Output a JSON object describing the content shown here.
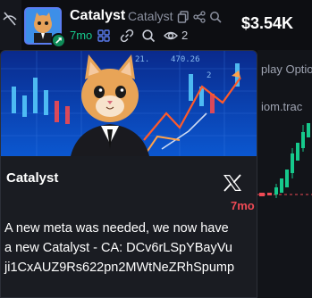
{
  "header": {
    "token_name": "Catalyst",
    "token_ticker": "Catalyst",
    "age": "7mo",
    "holders_count": "2",
    "market_cap": "$3.54K",
    "icons": [
      "copy-icon",
      "share-icon",
      "search-icon",
      "people-icon",
      "link-icon",
      "eye-icon"
    ]
  },
  "background": {
    "display_options_text": "play Optio",
    "domain_text": "iom.trac"
  },
  "popup": {
    "title": "Catalyst",
    "age": "7mo",
    "body_lines": [
      "A new meta was needed, we now have",
      "a new Catalyst - CA: DCv6rLSpYBayVu",
      "ji1CxAUZ9Rs622pn2MWtNeZRhSpump"
    ],
    "source_icon": "x-logo-icon"
  },
  "colors": {
    "accent_green": "#16c98c",
    "alert_red": "#ef4a55",
    "card_bg": "#1a1c22",
    "page_bg": "#0d0e12"
  }
}
